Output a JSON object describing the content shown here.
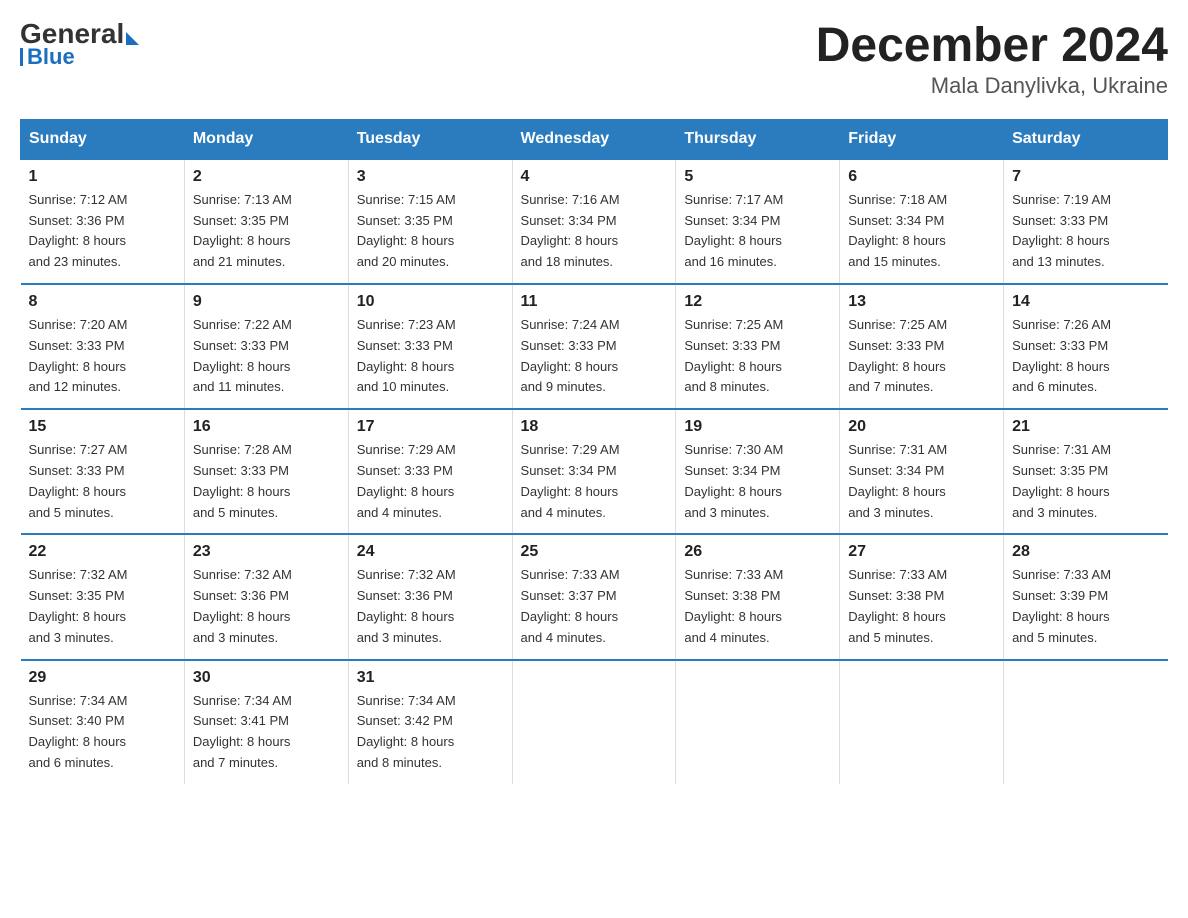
{
  "logo": {
    "general": "General",
    "blue": "Blue"
  },
  "title": "December 2024",
  "subtitle": "Mala Danylivka, Ukraine",
  "days_of_week": [
    "Sunday",
    "Monday",
    "Tuesday",
    "Wednesday",
    "Thursday",
    "Friday",
    "Saturday"
  ],
  "weeks": [
    [
      {
        "day": "1",
        "sunrise": "7:12 AM",
        "sunset": "3:36 PM",
        "daylight": "8 hours and 23 minutes."
      },
      {
        "day": "2",
        "sunrise": "7:13 AM",
        "sunset": "3:35 PM",
        "daylight": "8 hours and 21 minutes."
      },
      {
        "day": "3",
        "sunrise": "7:15 AM",
        "sunset": "3:35 PM",
        "daylight": "8 hours and 20 minutes."
      },
      {
        "day": "4",
        "sunrise": "7:16 AM",
        "sunset": "3:34 PM",
        "daylight": "8 hours and 18 minutes."
      },
      {
        "day": "5",
        "sunrise": "7:17 AM",
        "sunset": "3:34 PM",
        "daylight": "8 hours and 16 minutes."
      },
      {
        "day": "6",
        "sunrise": "7:18 AM",
        "sunset": "3:34 PM",
        "daylight": "8 hours and 15 minutes."
      },
      {
        "day": "7",
        "sunrise": "7:19 AM",
        "sunset": "3:33 PM",
        "daylight": "8 hours and 13 minutes."
      }
    ],
    [
      {
        "day": "8",
        "sunrise": "7:20 AM",
        "sunset": "3:33 PM",
        "daylight": "8 hours and 12 minutes."
      },
      {
        "day": "9",
        "sunrise": "7:22 AM",
        "sunset": "3:33 PM",
        "daylight": "8 hours and 11 minutes."
      },
      {
        "day": "10",
        "sunrise": "7:23 AM",
        "sunset": "3:33 PM",
        "daylight": "8 hours and 10 minutes."
      },
      {
        "day": "11",
        "sunrise": "7:24 AM",
        "sunset": "3:33 PM",
        "daylight": "8 hours and 9 minutes."
      },
      {
        "day": "12",
        "sunrise": "7:25 AM",
        "sunset": "3:33 PM",
        "daylight": "8 hours and 8 minutes."
      },
      {
        "day": "13",
        "sunrise": "7:25 AM",
        "sunset": "3:33 PM",
        "daylight": "8 hours and 7 minutes."
      },
      {
        "day": "14",
        "sunrise": "7:26 AM",
        "sunset": "3:33 PM",
        "daylight": "8 hours and 6 minutes."
      }
    ],
    [
      {
        "day": "15",
        "sunrise": "7:27 AM",
        "sunset": "3:33 PM",
        "daylight": "8 hours and 5 minutes."
      },
      {
        "day": "16",
        "sunrise": "7:28 AM",
        "sunset": "3:33 PM",
        "daylight": "8 hours and 5 minutes."
      },
      {
        "day": "17",
        "sunrise": "7:29 AM",
        "sunset": "3:33 PM",
        "daylight": "8 hours and 4 minutes."
      },
      {
        "day": "18",
        "sunrise": "7:29 AM",
        "sunset": "3:34 PM",
        "daylight": "8 hours and 4 minutes."
      },
      {
        "day": "19",
        "sunrise": "7:30 AM",
        "sunset": "3:34 PM",
        "daylight": "8 hours and 3 minutes."
      },
      {
        "day": "20",
        "sunrise": "7:31 AM",
        "sunset": "3:34 PM",
        "daylight": "8 hours and 3 minutes."
      },
      {
        "day": "21",
        "sunrise": "7:31 AM",
        "sunset": "3:35 PM",
        "daylight": "8 hours and 3 minutes."
      }
    ],
    [
      {
        "day": "22",
        "sunrise": "7:32 AM",
        "sunset": "3:35 PM",
        "daylight": "8 hours and 3 minutes."
      },
      {
        "day": "23",
        "sunrise": "7:32 AM",
        "sunset": "3:36 PM",
        "daylight": "8 hours and 3 minutes."
      },
      {
        "day": "24",
        "sunrise": "7:32 AM",
        "sunset": "3:36 PM",
        "daylight": "8 hours and 3 minutes."
      },
      {
        "day": "25",
        "sunrise": "7:33 AM",
        "sunset": "3:37 PM",
        "daylight": "8 hours and 4 minutes."
      },
      {
        "day": "26",
        "sunrise": "7:33 AM",
        "sunset": "3:38 PM",
        "daylight": "8 hours and 4 minutes."
      },
      {
        "day": "27",
        "sunrise": "7:33 AM",
        "sunset": "3:38 PM",
        "daylight": "8 hours and 5 minutes."
      },
      {
        "day": "28",
        "sunrise": "7:33 AM",
        "sunset": "3:39 PM",
        "daylight": "8 hours and 5 minutes."
      }
    ],
    [
      {
        "day": "29",
        "sunrise": "7:34 AM",
        "sunset": "3:40 PM",
        "daylight": "8 hours and 6 minutes."
      },
      {
        "day": "30",
        "sunrise": "7:34 AM",
        "sunset": "3:41 PM",
        "daylight": "8 hours and 7 minutes."
      },
      {
        "day": "31",
        "sunrise": "7:34 AM",
        "sunset": "3:42 PM",
        "daylight": "8 hours and 8 minutes."
      },
      null,
      null,
      null,
      null
    ]
  ],
  "labels": {
    "sunrise": "Sunrise:",
    "sunset": "Sunset:",
    "daylight": "Daylight:"
  }
}
